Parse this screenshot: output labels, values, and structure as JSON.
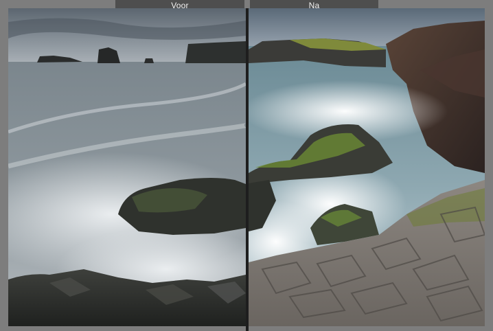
{
  "compare": {
    "before_label": "Voor",
    "after_label": "Na"
  },
  "colors": {
    "frame": "#7d7d7d",
    "label_bg": "#4e4e4e",
    "label_text": "#f2f2f2",
    "divider": "#1e1e1e"
  }
}
